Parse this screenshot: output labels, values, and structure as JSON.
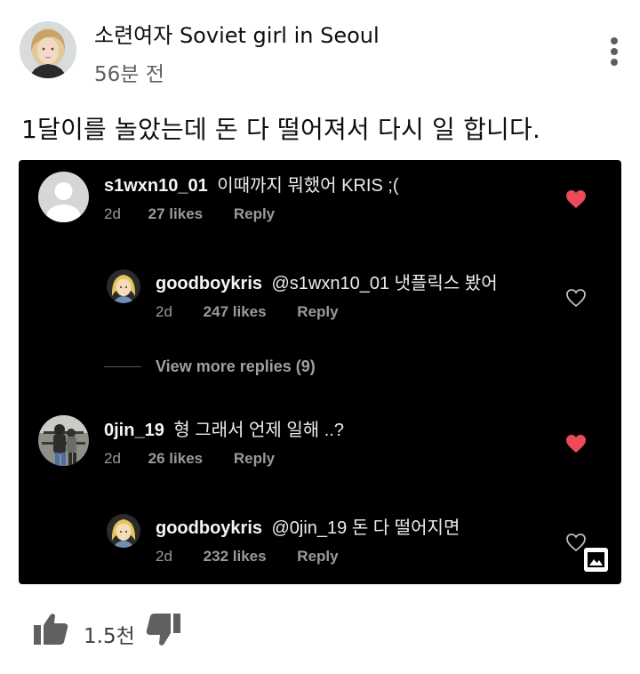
{
  "post": {
    "channel_name": "소련여자 Soviet girl in Seoul",
    "time_ago": "56분 전",
    "text": "1달이를 놀았는데 돈 다 떨어져서 다시 일 합니다.",
    "like_count": "1.5천",
    "icons": {
      "menu": "more-vert-icon",
      "like": "thumb-up-icon",
      "dislike": "thumb-down-icon"
    }
  },
  "comments_screenshot": {
    "comments": [
      {
        "user": "s1wxn10_01",
        "text": "이때까지 뭐했어 KRIS ;(",
        "age": "2d",
        "likes": "27 likes",
        "reply_label": "Reply",
        "liked": true,
        "replies": [
          {
            "user": "goodboykris",
            "text": "@s1wxn10_01 냇플릭스 봤어",
            "age": "2d",
            "likes": "247 likes",
            "reply_label": "Reply",
            "liked": false
          }
        ],
        "view_more_label": "View more replies (9)"
      },
      {
        "user": "0jin_19",
        "text": "형 그래서 언제 일해 ..?",
        "age": "2d",
        "likes": "26 likes",
        "reply_label": "Reply",
        "liked": true,
        "replies": [
          {
            "user": "goodboykris",
            "text": "@0jin_19 돈 다 떨어지면",
            "age": "2d",
            "likes": "232 likes",
            "reply_label": "Reply",
            "liked": false
          }
        ]
      }
    ],
    "heart_liked_color": "#ed4956",
    "heart_outline_color": "#bdbdbd"
  }
}
